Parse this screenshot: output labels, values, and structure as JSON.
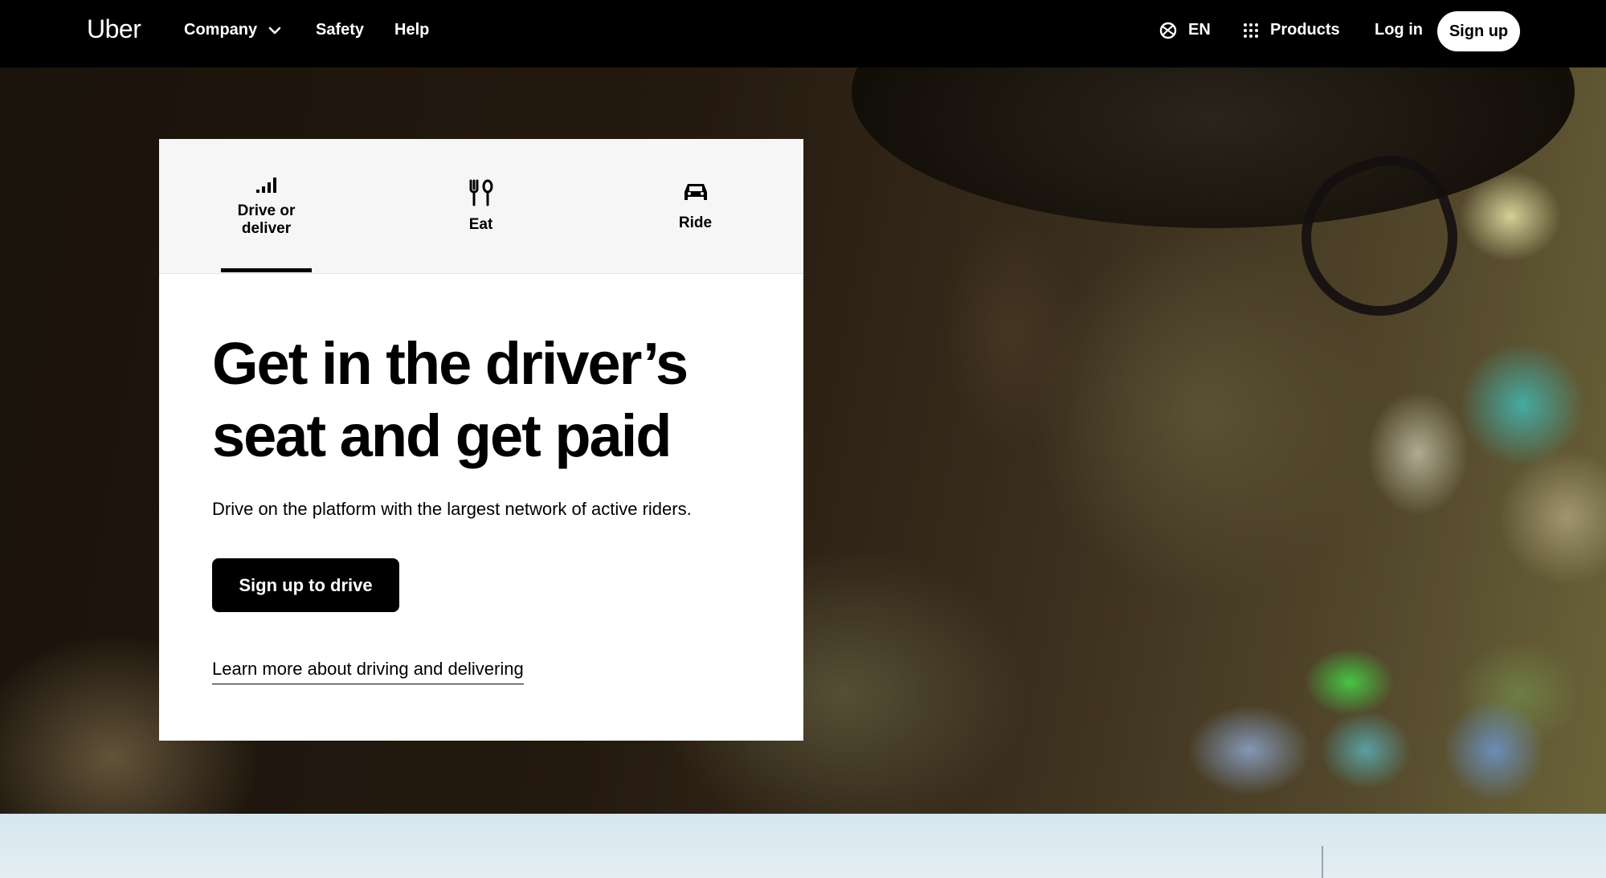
{
  "nav": {
    "logo": "Uber",
    "company": "Company",
    "safety": "Safety",
    "help": "Help",
    "language": "EN",
    "products": "Products",
    "login": "Log in",
    "signup": "Sign up"
  },
  "tabs": [
    {
      "label": "Drive or deliver",
      "icon": "bar-signal-icon",
      "active": true
    },
    {
      "label": "Eat",
      "icon": "fork-knife-icon",
      "active": false
    },
    {
      "label": "Ride",
      "icon": "car-icon",
      "active": false
    }
  ],
  "hero": {
    "headline": "Get in the driver’s\nseat and get paid",
    "subcopy": "Drive on the platform with the largest network of active riders.",
    "cta": "Sign up to drive",
    "learn_more": "Learn more about driving and delivering"
  },
  "colors": {
    "nav_bg": "#000000",
    "card_bg": "#ffffff",
    "tabs_bg": "#f6f6f6",
    "cta_bg": "#000000",
    "band_bg": "#dbe9f0"
  }
}
